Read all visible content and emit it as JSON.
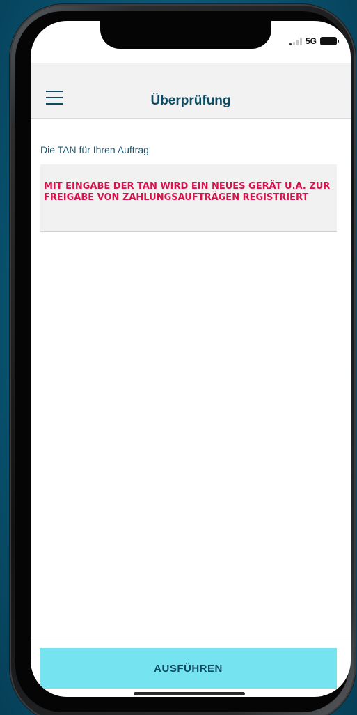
{
  "status_bar": {
    "network": "5G"
  },
  "header": {
    "title": "Überprüfung",
    "menu_icon": "hamburger-menu-icon"
  },
  "main": {
    "intro_text": "Die TAN für Ihren Auftrag",
    "warning_text": "MIT EINGABE DER TAN WIRD EIN NEUES GERÄT U.A. ZUR FREIGABE VON ZAHLUNGSAUFTRÄGEN REGISTRIERT"
  },
  "footer": {
    "execute_label": "AUSFÜHREN"
  },
  "colors": {
    "accent": "#76e3f0",
    "primary_text": "#0d4b63",
    "warning": "#d8124b",
    "background": "#0a5775"
  }
}
